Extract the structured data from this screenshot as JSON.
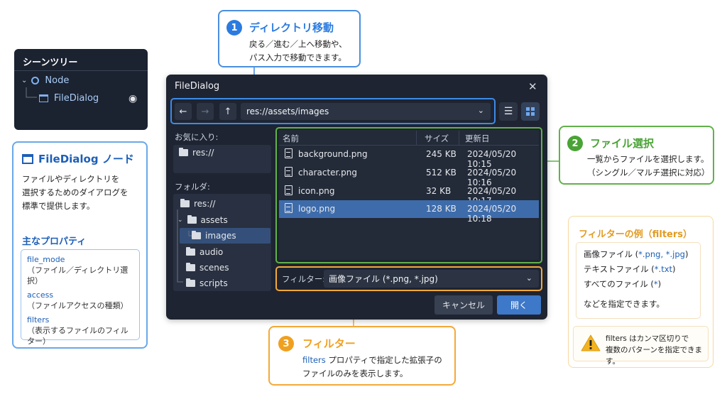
{
  "scene_tree": {
    "title": "シーンツリー",
    "root": "Node",
    "child": "FileDialog"
  },
  "node_card": {
    "title": "FileDialog ノード",
    "desc_lines": [
      "ファイルやディレクトリを",
      "選択するためのダイアログを",
      "標準で提供します。"
    ],
    "props_title": "主なプロパティ",
    "props": [
      {
        "name": "file_mode",
        "desc": "（ファイル／ディレクトリ選択）"
      },
      {
        "name": "access",
        "desc": "（ファイルアクセスの種類）"
      },
      {
        "name": "filters",
        "desc": "（表示するファイルのフィルター）"
      }
    ]
  },
  "callout1": {
    "number": "1",
    "title": "ディレクトリ移動",
    "lines": [
      "戻る／進む／上へ移動や、",
      "パス入力で移動できます。"
    ],
    "color": "#2b7be0"
  },
  "callout2": {
    "number": "2",
    "title": "ファイル選択",
    "lines": [
      "一覧からファイルを選択します。",
      "（シングル／マルチ選択に対応）"
    ],
    "color": "#4aa336"
  },
  "callout3": {
    "number": "3",
    "title": "フィルター",
    "keyword": "filters",
    "line1_rest": " プロパティで指定した拡張子の",
    "line2": "ファイルのみを表示します。",
    "color": "#f0a020"
  },
  "filter_examples": {
    "title": "フィルターの例（filters）",
    "ex1_prefix": "画像ファイル (",
    "ex1_value": "*.png, *.jpg",
    "ex1_suffix": ")",
    "ex2_prefix": "テキストファイル (",
    "ex2_value": "*.txt",
    "ex2_suffix": ")",
    "ex3_prefix": "すべてのファイル (",
    "ex3_value": "*",
    "ex3_suffix": ")",
    "footer": "などを指定できます。",
    "note_line1": "filters はカンマ区切りで",
    "note_line2": "複数のパターンを指定できます。"
  },
  "dialog": {
    "title": "FileDialog",
    "close": "✕",
    "back": "←",
    "forward": "→",
    "up": "↑",
    "path": "res://assets/images",
    "favorites_label": "お気に入り:",
    "favorite_item": "res://",
    "folders_label": "フォルダ:",
    "folders": [
      "res://",
      "assets",
      "images",
      "audio",
      "scenes",
      "scripts"
    ],
    "columns": {
      "name": "名前",
      "size": "サイズ",
      "modified": "更新日"
    },
    "files": [
      {
        "name": "background.png",
        "size": "245 KB",
        "date": "2024/05/20 10:15"
      },
      {
        "name": "character.png",
        "size": "512 KB",
        "date": "2024/05/20 10:16"
      },
      {
        "name": "icon.png",
        "size": "32 KB",
        "date": "2024/05/20 10:17"
      },
      {
        "name": "logo.png",
        "size": "128 KB",
        "date": "2024/05/20 10:18"
      }
    ],
    "filter_label": "フィルター:",
    "filter_value": "画像ファイル (*.png, *.jpg)",
    "cancel": "キャンセル",
    "open": "開く"
  }
}
